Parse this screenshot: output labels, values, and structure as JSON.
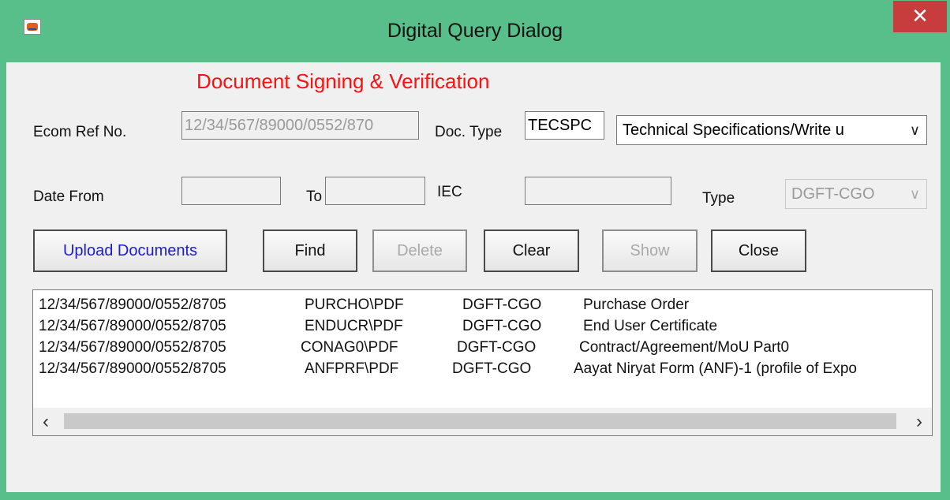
{
  "window": {
    "title": "Digital Query Dialog",
    "close_glyph": "✕"
  },
  "form": {
    "heading": "Document Signing &  Verification",
    "ecom_ref_label": "Ecom Ref No.",
    "ecom_ref_value": "12/34/567/89000/0552/870",
    "doc_type_label": "Doc. Type",
    "doc_type_code": "TECSPC",
    "doc_type_selected": "Technical Specifications/Write u",
    "date_from_label": "Date From",
    "date_from_value": "",
    "to_label": "To",
    "to_value": "",
    "iec_label": "IEC",
    "iec_value": "",
    "type_label": "Type",
    "type_selected": "DGFT-CGO"
  },
  "buttons": {
    "upload": "Upload Documents",
    "find": "Find",
    "delete": "Delete",
    "clear": "Clear",
    "show": "Show",
    "close": "Close"
  },
  "documents": [
    {
      "ref": "12/34/567/89000/0552/8705",
      "file": "PURCHO\\PDF",
      "type": "DGFT-CGO",
      "desc": "Purchase Order"
    },
    {
      "ref": "12/34/567/89000/0552/8705",
      "file": "ENDUCR\\PDF",
      "type": "DGFT-CGO",
      "desc": "End User Certificate"
    },
    {
      "ref": "12/34/567/89000/0552/8705",
      "file": "CONAG0\\PDF",
      "type": "DGFT-CGO",
      "desc": "Contract/Agreement/MoU Part0"
    },
    {
      "ref": "12/34/567/89000/0552/8705",
      "file": "ANFPRF\\PDF",
      "type": "DGFT-CGO",
      "desc": "Aayat Niryat Form (ANF)-1 (profile of Expo"
    }
  ],
  "scrollbar": {
    "left_glyph": "‹",
    "right_glyph": "›"
  },
  "colors": {
    "frame": "#58bf8b",
    "heading": "#ff1010",
    "upload_text": "#1b1bd9",
    "close_button": "#c73c3c"
  }
}
